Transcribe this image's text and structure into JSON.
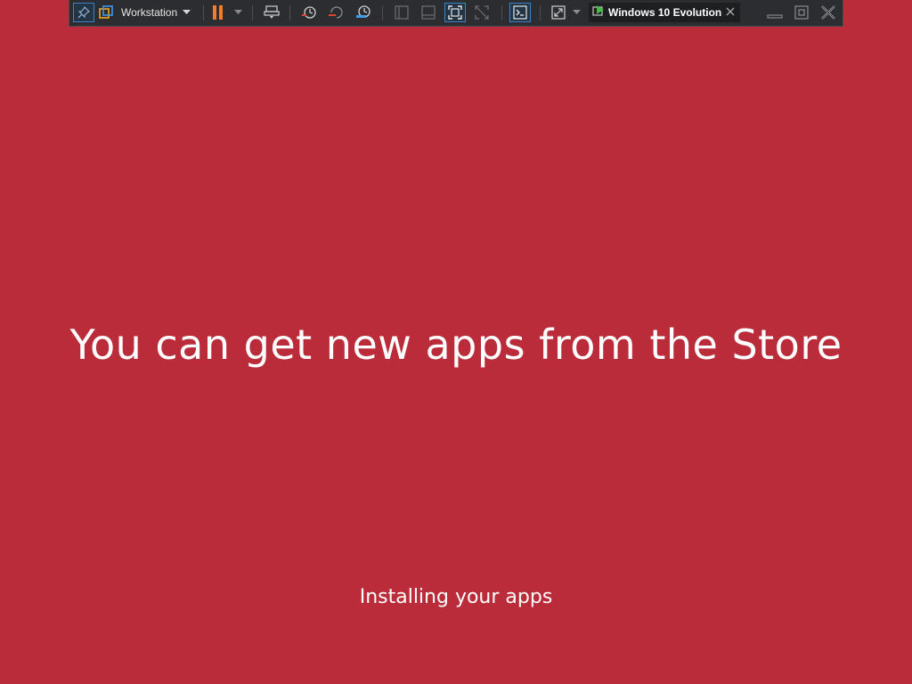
{
  "toolbar": {
    "menu_label": "Workstation",
    "vm_tab_title": "Windows 10 Evolution",
    "icons": {
      "pin": "pin-icon",
      "library": "library-icon",
      "menu_dropdown": "chevron-down-icon",
      "pause": "pause-icon",
      "power_dropdown": "chevron-down-icon",
      "send_keys": "send-ctrl-alt-del-icon",
      "take_snapshot": "take-snapshot-icon",
      "revert_snapshot": "revert-snapshot-icon",
      "snapshot_manager": "snapshot-manager-icon",
      "show_library": "library-view-icon",
      "thumbnail_bar": "thumbnail-bar-icon",
      "full_screen": "full-screen-icon",
      "unity": "unity-icon",
      "console_view": "console-view-icon",
      "stretch_guest": "stretch-icon",
      "stretch_dropdown": "chevron-down-icon",
      "vm_running": "vm-running-icon",
      "tab_close": "close-icon",
      "minimize": "minimize-icon",
      "restore": "restore-icon",
      "close": "close-icon"
    },
    "colors": {
      "background": "#2b2d30",
      "active_border": "#3d82c4",
      "pause_orange": "#f57c2a"
    }
  },
  "oobe": {
    "headline": "You can get new apps from the Store",
    "status": "Installing your apps",
    "background_color": "#bb2c3a"
  }
}
